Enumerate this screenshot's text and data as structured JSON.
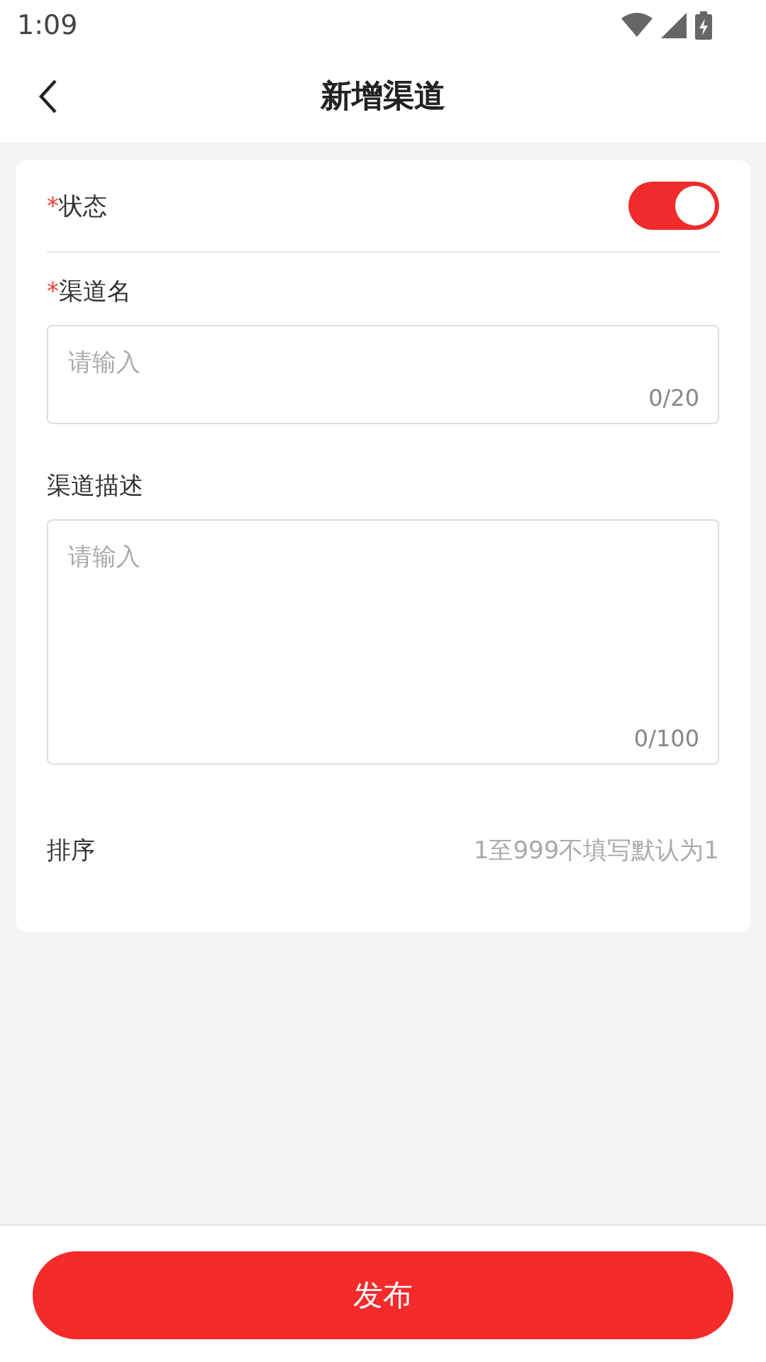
{
  "status_bar": {
    "time": "1:09"
  },
  "header": {
    "title": "新增渠道"
  },
  "fields": [
    {
      "kind": "switch",
      "label": "状态",
      "required_mark": "*",
      "on": true
    },
    {
      "kind": "input",
      "label": "渠道名",
      "required_mark": "*",
      "placeholder": "请输入",
      "counter": "0/20"
    },
    {
      "kind": "textarea",
      "label": "渠道描述",
      "placeholder": "请输入",
      "counter": "0/100"
    },
    {
      "kind": "inline",
      "label": "排序",
      "placeholder": "1至999不填写默认为1"
    }
  ],
  "submit": {
    "label": "发布"
  }
}
